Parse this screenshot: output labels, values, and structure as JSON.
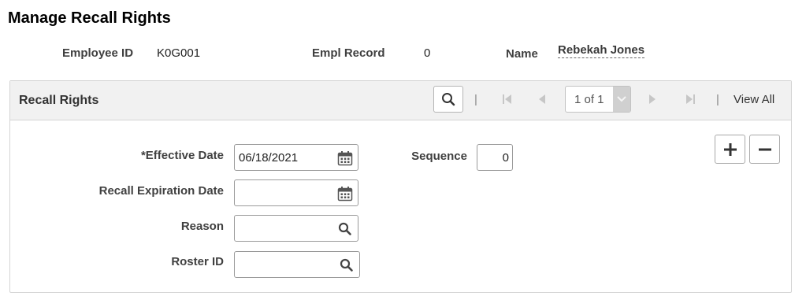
{
  "page": {
    "title": "Manage Recall Rights"
  },
  "header": {
    "employee_id_label": "Employee ID",
    "employee_id_value": "K0G001",
    "empl_record_label": "Empl Record",
    "empl_record_value": "0",
    "name_label": "Name",
    "name_value": "Rebekah Jones"
  },
  "grid": {
    "title": "Recall Rights",
    "separator": "|",
    "pager_text": "1 of 1",
    "view_all": "View All"
  },
  "form": {
    "effective_date_label": "*Effective Date",
    "effective_date_value": "06/18/2021",
    "sequence_label": "Sequence",
    "sequence_value": "0",
    "recall_expiration_label": "Recall Expiration Date",
    "recall_expiration_value": "",
    "reason_label": "Reason",
    "reason_value": "",
    "roster_id_label": "Roster ID",
    "roster_id_value": ""
  },
  "icons": {
    "search": "search-icon",
    "calendar": "calendar-icon",
    "first": "first-page-icon",
    "previous": "previous-icon",
    "next": "next-icon",
    "last": "last-page-icon",
    "dropdown": "chevron-down-icon",
    "add": "plus-icon",
    "delete": "minus-icon"
  },
  "colors": {
    "header_bg": "#f1f1f1",
    "border": "#d4d4d4",
    "disabled_icon": "#c6c6c6",
    "text": "#333333"
  }
}
